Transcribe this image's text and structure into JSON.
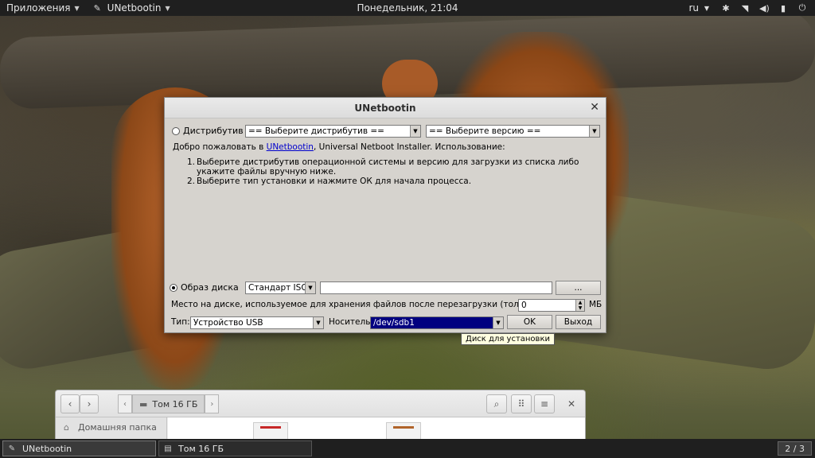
{
  "topbar": {
    "applications_label": "Приложения",
    "active_app_label": "UNetbootin",
    "clock": "Понедельник, 21:04",
    "language": "ru"
  },
  "dialog": {
    "title": "UNetbootin",
    "distro_radio_label": "Дистрибутив",
    "distro_select_value": "== Выберите дистрибутив ==",
    "version_select_value": "== Выберите версию ==",
    "welcome_prefix": "Добро пожаловать в ",
    "welcome_link": "UNetbootin",
    "welcome_suffix": ", Universal Netboot Installer. Использование:",
    "steps": [
      {
        "num": "1.",
        "text": "Выберите дистрибутив операционной системы и версию для загрузки из списка либо укажите файлы вручную ниже."
      },
      {
        "num": "2.",
        "text": "Выберите тип установки и нажмите ОК для начала процесса."
      }
    ],
    "diskimage_radio_label": "Образ диска",
    "diskimage_type_value": "Стандарт ISO",
    "diskimage_path_value": "",
    "browse_button_label": "...",
    "space_label": "Место на диске, используемое для хранения файлов после перезагрузки (только Ubuntu):",
    "space_value": "0",
    "space_unit": "МБ",
    "type_label": "Тип:",
    "type_value": "Устройство USB",
    "drive_label": "Носитель:",
    "drive_value": "/dev/sdb1",
    "ok_label": "OK",
    "exit_label": "Выход"
  },
  "tooltip": "Диск для установки",
  "file_manager": {
    "path_segment": "Том 16 ГБ",
    "sidebar_home": "Домашняя папка"
  },
  "taskbar": {
    "tasks": [
      {
        "label": "UNetbootin"
      },
      {
        "label": "Том 16 ГБ"
      }
    ],
    "workspace": "2 / 3"
  }
}
